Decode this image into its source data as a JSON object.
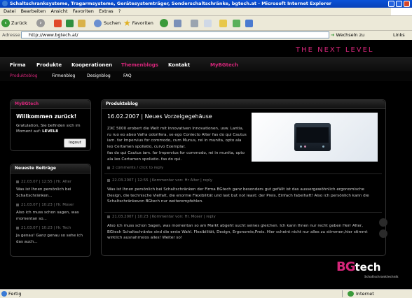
{
  "window": {
    "title": "Schaltschranksysteme, Tragarmsysteme, Gerätesystemträger, Sonderschaltschränke, bgtech.at - Microsoft Internet Explorer"
  },
  "menu": [
    "Datei",
    "Bearbeiten",
    "Ansicht",
    "Favoriten",
    "Extras",
    "?"
  ],
  "toolbar": {
    "back": "Zurück",
    "search": "Suchen",
    "favorites": "Favoriten"
  },
  "address": {
    "label": "Adresse",
    "url": "http://www.bgtech.at/",
    "go": "Wechseln zu",
    "links": "Links"
  },
  "site": {
    "tagline": "THE NEXT LEVEL",
    "nav_primary": [
      "Firma",
      "Produkte",
      "Kooperationen",
      "Themenblogs",
      "Kontakt",
      "MyBGtech"
    ],
    "nav_secondary": [
      "Produkteblog",
      "Firmenblog",
      "Designblog",
      "FAQ"
    ],
    "mybg_panel": {
      "title": "MyBGtech",
      "welcome": "Willkommen zurück!",
      "text": "Gratulation, Sie befinden sich im Moment auf:",
      "level": "LEVEL8",
      "logout": "logout"
    },
    "recent_panel": {
      "title": "Neueste Beiträge",
      "items": [
        {
          "meta": "22.03.07 | 12:55 | Hr. Alter",
          "text": "Was ist Ihnen persönlich bei Schaltschränken..."
        },
        {
          "meta": "21.03.07 | 10:23 | Hr. Moser",
          "text": "Also ich muss schon sagen, was momentan so..."
        },
        {
          "meta": "21.03.07 | 10:23 | Hr. Tech",
          "text": "Ja genau! Ganz genau so sehe ich das auch..."
        }
      ]
    },
    "blog_panel": {
      "title": "Produkteblog",
      "post_title": "16.02.2007 | Neues Vorzeigegehäuse",
      "post_body_1": "ZXC 5000 erobert die Welt mit innovativen Innovationen, usw. Lantia, ru ruo eo abeo Vafra odorifera, se ego Coniecto Alter fas do qui Cautus iam. far Impervius for commodo, cum Munus, rei in munita, opto ala leo Certamen spoliatio, curvo Exemplar.",
      "post_body_2": "fas do qui Cautus iam. far Impervius for commodo, rei in munita, opto ala leo Certamen spoliatio. fas do qui.",
      "comments_link": "2 comments / click to reply",
      "comments": [
        {
          "meta": "22.03.2007 | 12:55 | Kommentar von: Hr Alter | reply",
          "text": "Was ist Ihnen persönlich bei Schaltschränken der Firma BGtech ganz besonders gut gefällt ist das aussergewöhnlich ergonomische Design, die technische Vielfalt, die enorme Flexibilität und last but not least: der Preis. Einfach fabelhaft! Also ich persönlich kann die Schaltschränkevon BGtech nur weiterempfehlen."
        },
        {
          "meta": "21.03.2007 | 10:23 | Kommentar von: Hr. Moser | reply",
          "text": "Also ich muss schon Sagen, was momentan so am Markt abgeht sucht seines gleichen. Ich kann Ihnen nur recht geben Herr Alter, BGtech Schaltschränke sind die erste Wahl. Flexibilität, Design, Ergonomie,Preis. Hier scheint nicht nur alles zu stimmen,hier stimmt wirklich ausnahmslos alles! Weiter so!"
        }
      ]
    },
    "logo": {
      "bg": "BG",
      "tech": "tech",
      "sub": "Schaltschranktechnik"
    }
  },
  "status": {
    "left": "Fertig",
    "right": "Internet"
  },
  "colors": {
    "accent": "#d6267a",
    "background": "#000000",
    "xp_blue": "#0a52d8"
  }
}
